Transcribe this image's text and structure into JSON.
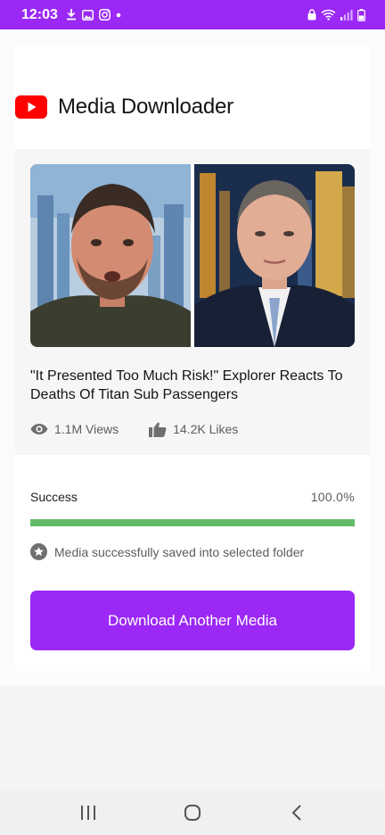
{
  "status_bar": {
    "time": "12:03",
    "bg_color": "#9b28f5",
    "left_icons": [
      "download-icon",
      "image-icon",
      "instagram-icon",
      "dot-icon"
    ],
    "right_icons": [
      "lock-icon",
      "wifi-icon",
      "signal-icon",
      "battery-icon"
    ]
  },
  "header": {
    "app_title": "Media Downloader",
    "logo": "youtube-logo"
  },
  "video": {
    "thumbnail_alt": "Video thumbnail",
    "title": "\"It Presented Too Much Risk!\" Explorer Reacts To Deaths Of Titan Sub Passengers",
    "views": "1.1M Views",
    "likes": "14.2K Likes"
  },
  "download": {
    "status_label": "Success",
    "percent_text": "100.0%",
    "progress_fraction": 1.0,
    "progress_color": "#66bb6a",
    "message": "Media successfully saved into selected folder",
    "button_label": "Download Another Media",
    "button_color": "#9b28f5"
  },
  "nav": {
    "items": [
      "recent-apps-icon",
      "home-icon",
      "back-icon"
    ]
  }
}
